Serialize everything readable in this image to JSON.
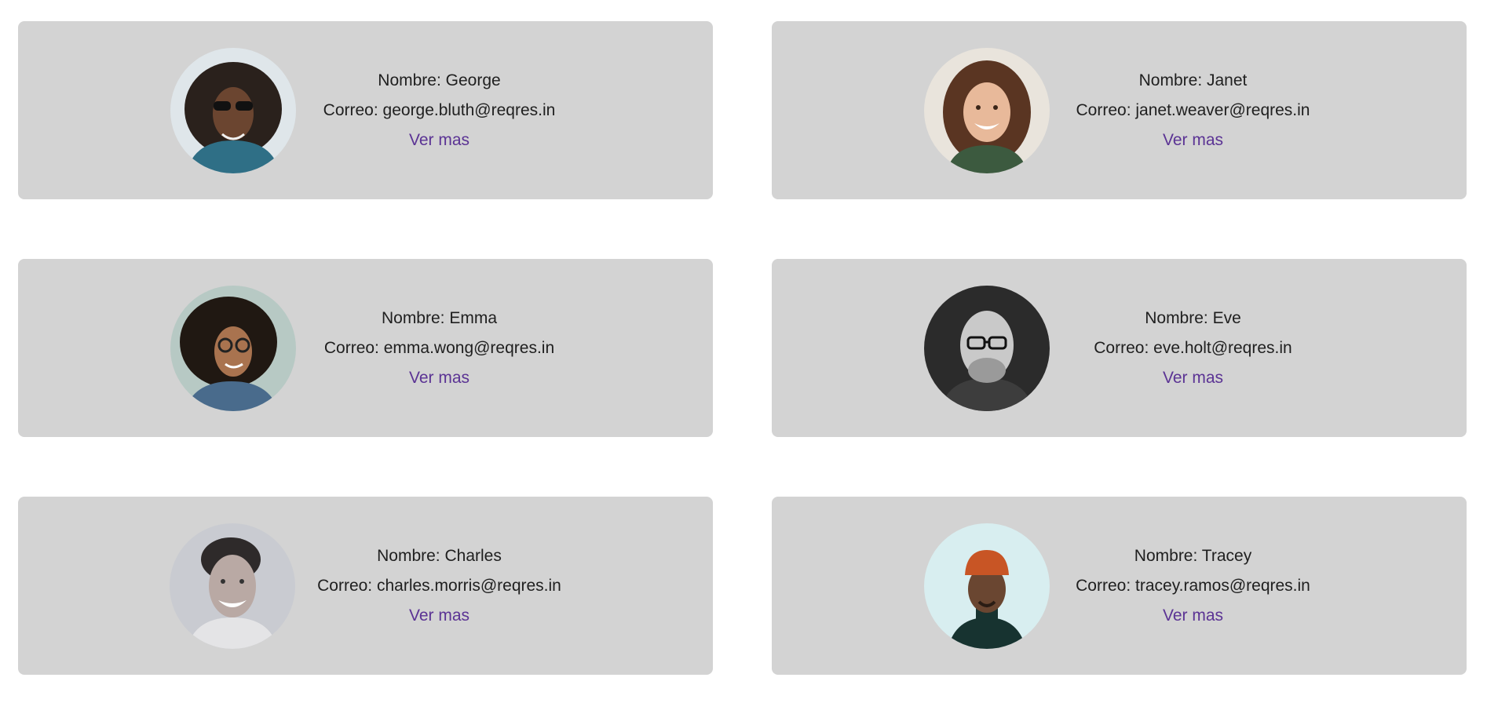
{
  "labels": {
    "name_prefix": "Nombre:",
    "email_prefix": "Correo:"
  },
  "users": [
    {
      "first_name": "George",
      "email": "george.bluth@reqres.in",
      "link": "Ver mas"
    },
    {
      "first_name": "Janet",
      "email": "janet.weaver@reqres.in",
      "link": "Ver mas"
    },
    {
      "first_name": "Emma",
      "email": "emma.wong@reqres.in",
      "link": "Ver mas"
    },
    {
      "first_name": "Eve",
      "email": "eve.holt@reqres.in",
      "link": "Ver mas"
    },
    {
      "first_name": "Charles",
      "email": "charles.morris@reqres.in",
      "link": "Ver mas"
    },
    {
      "first_name": "Tracey",
      "email": "tracey.ramos@reqres.in",
      "link": "Ver mas"
    }
  ],
  "colors": {
    "card_background": "#d3d3d3",
    "link": "#5b3394",
    "text": "#1f1f1f"
  }
}
